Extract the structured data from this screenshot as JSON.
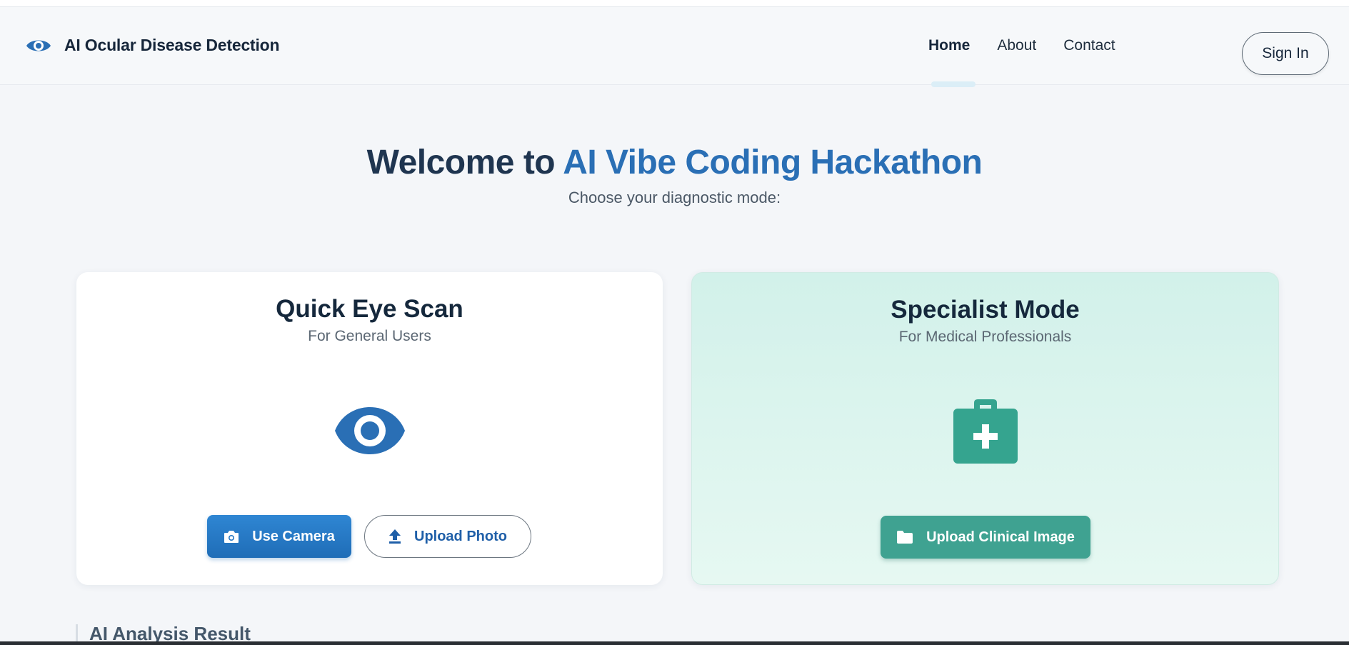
{
  "header": {
    "brand_title": "AI Ocular Disease Detection",
    "brand_icon": "eye-icon",
    "nav": [
      {
        "label": "Home",
        "active": true
      },
      {
        "label": "About",
        "active": false
      },
      {
        "label": "Contact",
        "active": false
      }
    ],
    "signin_label": "Sign In"
  },
  "hero": {
    "title_prefix": "Welcome to ",
    "title_accent": "AI Vibe Coding Hackathon",
    "subtitle": "Choose your diagnostic mode:"
  },
  "cards": {
    "quick": {
      "title": "Quick Eye Scan",
      "subtitle": "For General Users",
      "icon": "eye-icon",
      "camera_label": "Use Camera",
      "camera_icon": "camera-icon",
      "upload_label": "Upload Photo",
      "upload_icon": "upload-icon"
    },
    "specialist": {
      "title": "Specialist Mode",
      "subtitle": "For Medical Professionals",
      "icon": "medical-kit-icon",
      "upload_label": "Upload Clinical Image",
      "upload_icon": "folder-icon"
    }
  },
  "result": {
    "title": "AI Analysis Result"
  },
  "colors": {
    "accent_blue": "#2a6fb5",
    "accent_teal": "#3fa291",
    "background": "#f4f6f9"
  }
}
